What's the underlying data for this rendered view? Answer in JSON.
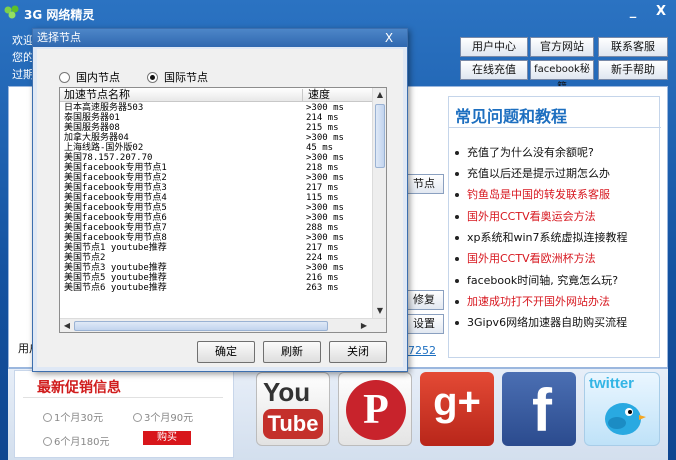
{
  "app": {
    "title": "3G 网络精灵",
    "welcome_lines": [
      "欢迎",
      "您的",
      "过期"
    ]
  },
  "window_controls": {
    "minimize": "_",
    "close": "X"
  },
  "top_buttons": [
    "用户中心",
    "官方网站",
    "联系客服",
    "在线充值",
    "facebook秘籍",
    "新手帮助"
  ],
  "side_buttons": [
    "节点",
    "修复",
    "设置"
  ],
  "partial_text": {
    "left": "用户",
    "link": "7252"
  },
  "faq": {
    "title": "常见问题和教程",
    "items": [
      {
        "text": "充值了为什么没有余额呢?",
        "color": "#111111"
      },
      {
        "text": "充值以后还是提示过期怎么办",
        "color": "#111111"
      },
      {
        "text": "钓鱼岛是中国的转发联系客服",
        "color": "#d7171f"
      },
      {
        "text": "国外用CCTV看奥运会方法",
        "color": "#d7171f"
      },
      {
        "text": "xp系统和win7系统虚拟连接教程",
        "color": "#111111"
      },
      {
        "text": "国外用CCTV看欧洲杯方法",
        "color": "#d7171f"
      },
      {
        "text": "facebook时间轴, 究竟怎么玩?",
        "color": "#111111"
      },
      {
        "text": "加速成功打不开国外网站办法",
        "color": "#d7171f"
      },
      {
        "text": "3Gipv6网络加速器自助购买流程",
        "color": "#111111"
      }
    ]
  },
  "promo": {
    "title": "最新促销信息",
    "options": [
      "1个月30元",
      "3个月90元",
      "6个月180元"
    ],
    "buy_label": "购买"
  },
  "social": [
    {
      "name": "youtube",
      "lines": [
        "You",
        "Tube"
      ]
    },
    {
      "name": "pinterest",
      "glyph": "P"
    },
    {
      "name": "google-plus",
      "glyph": "g+"
    },
    {
      "name": "facebook",
      "glyph": "f"
    },
    {
      "name": "twitter",
      "word": "twitter"
    }
  ],
  "dialog": {
    "title": "选择节点",
    "close": "X",
    "radio_domestic": "国内节点",
    "radio_international": "国际节点",
    "selected": "国际节点",
    "columns": [
      "加速节点名称",
      "速度"
    ],
    "rows": [
      [
        "日本高速服务器503",
        ">300 ms"
      ],
      [
        "泰国服务器01",
        "214 ms"
      ],
      [
        "美国服务器08",
        "215 ms"
      ],
      [
        "加拿大服务器04",
        ">300 ms"
      ],
      [
        "上海线路-国外版02",
        "45 ms"
      ],
      [
        "美国78.157.207.70",
        ">300 ms"
      ],
      [
        "美国facebook专用节点1",
        "218 ms"
      ],
      [
        "美国facebook专用节点2",
        ">300 ms"
      ],
      [
        "美国facebook专用节点3",
        "217 ms"
      ],
      [
        "美国facebook专用节点4",
        "115 ms"
      ],
      [
        "美国facebook专用节点5",
        ">300 ms"
      ],
      [
        "美国facebook专用节点6",
        ">300 ms"
      ],
      [
        "美国facebook专用节点7",
        "288 ms"
      ],
      [
        "美国facebook专用节点8",
        ">300 ms"
      ],
      [
        "美国节点1  youtube推荐",
        "217 ms"
      ],
      [
        "美国节点2",
        "224 ms"
      ],
      [
        "美国节点3 youtube推荐",
        ">300 ms"
      ],
      [
        "美国节点5   youtube推荐",
        "216 ms"
      ],
      [
        "美国节点6 youtube推荐",
        "263 ms"
      ]
    ],
    "buttons": {
      "ok": "确定",
      "refresh": "刷新",
      "close": "关闭"
    }
  }
}
